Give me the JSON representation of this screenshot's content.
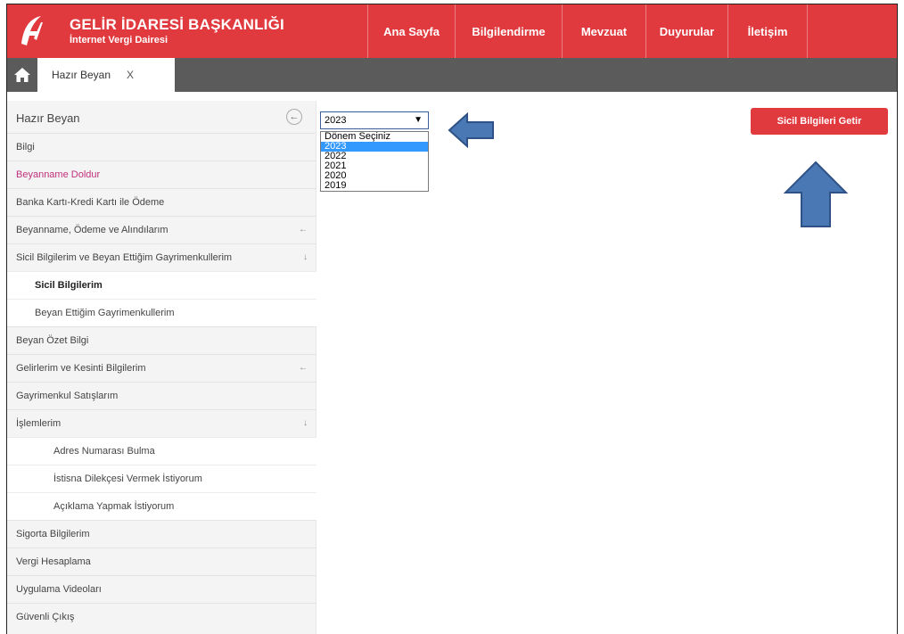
{
  "header": {
    "title": "GELİR İDARESİ BAŞKANLIĞI",
    "subtitle": "İnternet Vergi Dairesi",
    "nav": [
      "Ana Sayfa",
      "Bilgilendirme",
      "Mevzuat",
      "Duyurular",
      "İletişim"
    ]
  },
  "tabs": {
    "active_label": "Hazır Beyan",
    "close_label": "X"
  },
  "sidebar": {
    "title": "Hazır Beyan",
    "toggle_icon": "←",
    "items": [
      {
        "label": "Bilgi"
      },
      {
        "label": "Beyanname Doldur"
      },
      {
        "label": "Banka Kartı-Kredi Kartı ile Ödeme"
      },
      {
        "label": "Beyanname, Ödeme ve Alındılarım",
        "arrow": "←"
      },
      {
        "label": "Sicil Bilgilerim ve Beyan Ettiğim Gayrimenkullerim",
        "arrow": "↓"
      },
      {
        "label": "Sicil Bilgilerim"
      },
      {
        "label": "Beyan Ettiğim Gayrimenkullerim"
      },
      {
        "label": "Beyan Özet Bilgi"
      },
      {
        "label": "Gelirlerim ve Kesinti Bilgilerim",
        "arrow": "←"
      },
      {
        "label": "Gayrimenkul Satışlarım"
      },
      {
        "label": "İşlemlerim",
        "arrow": "↓"
      },
      {
        "label": "Adres Numarası Bulma"
      },
      {
        "label": "İstisna Dilekçesi Vermek İstiyorum"
      },
      {
        "label": "Açıklama Yapmak İstiyorum"
      },
      {
        "label": "Sigorta Bilgilerim"
      },
      {
        "label": "Vergi Hesaplama"
      },
      {
        "label": "Uygulama Videoları"
      },
      {
        "label": "Güvenli Çıkış"
      }
    ]
  },
  "period_select": {
    "value": "2023",
    "options": [
      "Dönem Seçiniz",
      "2023",
      "2022",
      "2021",
      "2020",
      "2019"
    ],
    "selected_index": 1
  },
  "actions": {
    "fetch_button": "Sicil Bilgileri Getir"
  },
  "colors": {
    "brand_red": "#e13a3e",
    "tab_bar": "#5b5b5b",
    "active_menu": "#c0307c",
    "annotation_arrow": "#4a78b5"
  }
}
